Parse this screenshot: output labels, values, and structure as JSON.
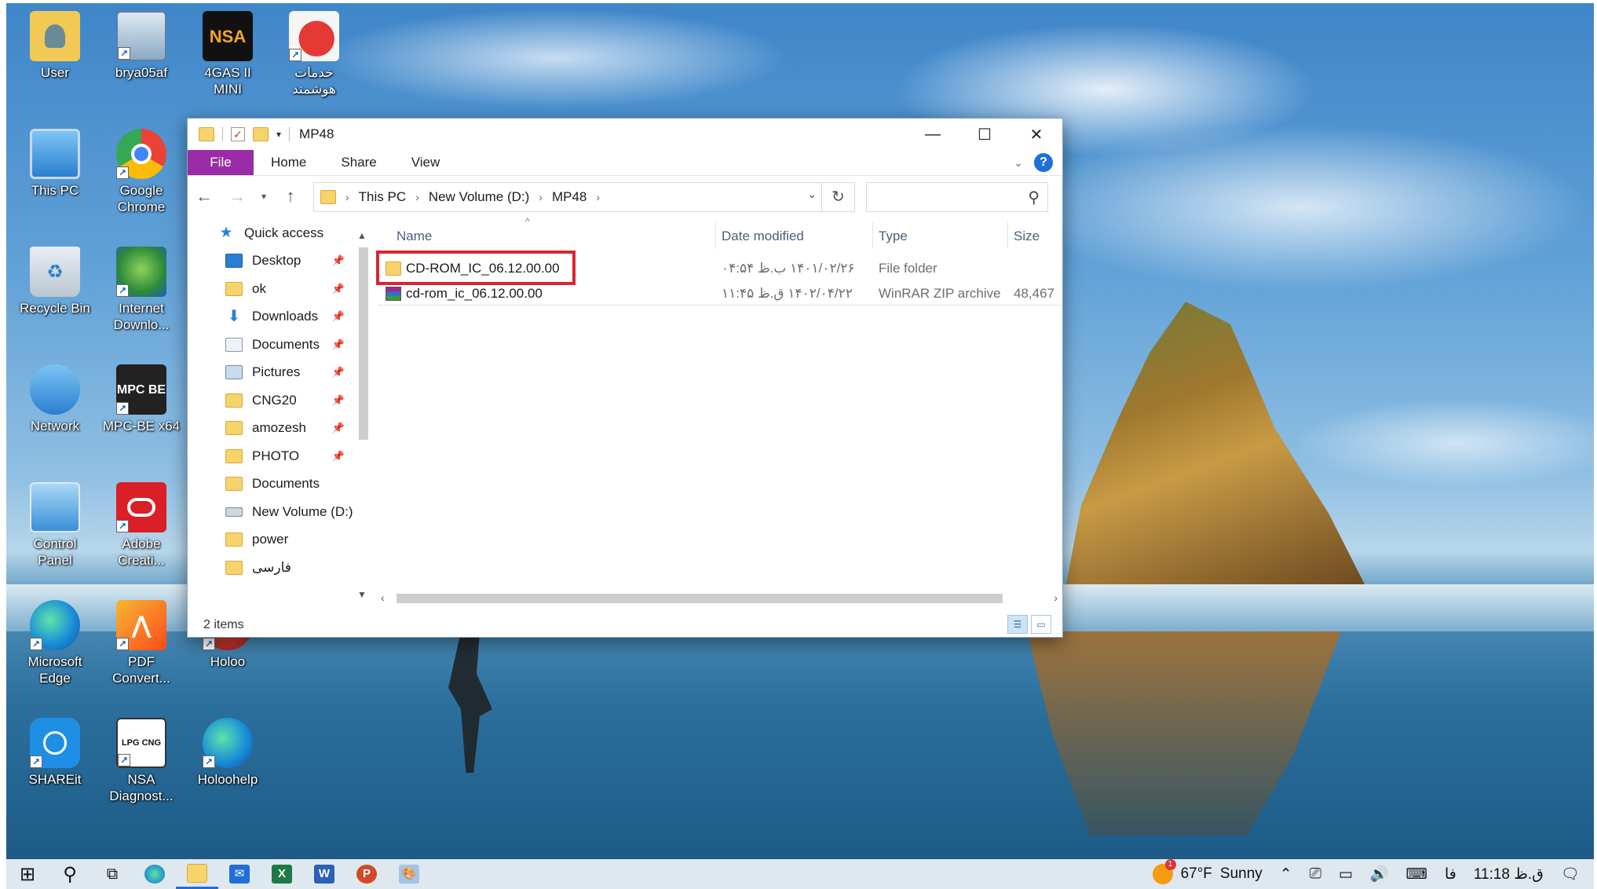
{
  "desktop": {
    "icons": [
      {
        "label": "User"
      },
      {
        "label": "brya05af"
      },
      {
        "label": "4GAS II MINI"
      },
      {
        "label": "خدمات هوشمند"
      },
      {
        "label": "This PC"
      },
      {
        "label": "Google Chrome"
      },
      {
        "label": "Recycle Bin"
      },
      {
        "label": "Internet Downlo..."
      },
      {
        "label": "Network"
      },
      {
        "label": "MPC-BE x64"
      },
      {
        "label": "Control Panel"
      },
      {
        "label": "Adobe Creati..."
      },
      {
        "label": "Microsoft Edge"
      },
      {
        "label": "PDF Convert..."
      },
      {
        "label": "Holoo"
      },
      {
        "label": "SHAREit"
      },
      {
        "label": "NSA Diagnost..."
      },
      {
        "label": "Holoohelp"
      }
    ],
    "nsa_logo_text": "NSA",
    "mpc_logo_text": "MPC BE",
    "lpg_logo_text": "LPG CNG"
  },
  "window": {
    "title": "MP48",
    "ribbon_tabs": [
      "File",
      "Home",
      "Share",
      "View"
    ],
    "help_label": "?",
    "breadcrumb": [
      "This PC",
      "New Volume (D:)",
      "MP48"
    ],
    "search_placeholder": "",
    "nav_items": [
      {
        "label": "Quick access",
        "icon": "star-icon",
        "pinned": false
      },
      {
        "label": "Desktop",
        "icon": "desktop-icon",
        "pinned": true
      },
      {
        "label": "ok",
        "icon": "folder-icon",
        "pinned": true
      },
      {
        "label": "Downloads",
        "icon": "download-icon",
        "pinned": true
      },
      {
        "label": "Documents",
        "icon": "documents-icon",
        "pinned": true
      },
      {
        "label": "Pictures",
        "icon": "pictures-icon",
        "pinned": true
      },
      {
        "label": "CNG20",
        "icon": "folder-icon",
        "pinned": true
      },
      {
        "label": "amozesh",
        "icon": "folder-icon",
        "pinned": true
      },
      {
        "label": "PHOTO",
        "icon": "folder-icon",
        "pinned": true
      },
      {
        "label": "Documents",
        "icon": "folder-icon",
        "pinned": false
      },
      {
        "label": "New Volume (D:)",
        "icon": "drive-icon",
        "pinned": false
      },
      {
        "label": "power",
        "icon": "folder-icon",
        "pinned": false
      },
      {
        "label": "فارسی",
        "icon": "folder-icon",
        "pinned": false
      }
    ],
    "columns": {
      "name": "Name",
      "date": "Date modified",
      "type": "Type",
      "size": "Size"
    },
    "files": [
      {
        "name": "CD-ROM_IC_06.12.00.00",
        "date": "۱۴۰۱/۰۲/۲۶ ب.ظ ۰۴:۵۴",
        "type": "File folder",
        "size": "",
        "icon": "folder-icon"
      },
      {
        "name": "cd-rom_ic_06.12.00.00",
        "date": "۱۴۰۲/۰۴/۲۲ ق.ظ ۱۱:۴۵",
        "type": "WinRAR ZIP archive",
        "size": "48,467",
        "icon": "winrar-icon"
      }
    ],
    "status": "2 items"
  },
  "taskbar": {
    "weather_temp": "67°F",
    "weather_desc": "Sunny",
    "weather_badge": "1",
    "lang": "فا",
    "time": "11:18 ق.ظ"
  }
}
